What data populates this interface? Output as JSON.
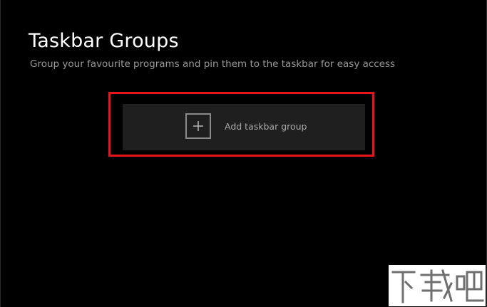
{
  "app": {
    "title": "Taskbar Groups",
    "subtitle": "Group your favourite programs and pin them to the taskbar for easy access"
  },
  "actions": {
    "add_group_label": "Add taskbar group",
    "add_group_icon": "plus-icon"
  },
  "annotation": {
    "highlight_color": "#e8141b"
  },
  "watermark": {
    "text": "下载吧"
  }
}
